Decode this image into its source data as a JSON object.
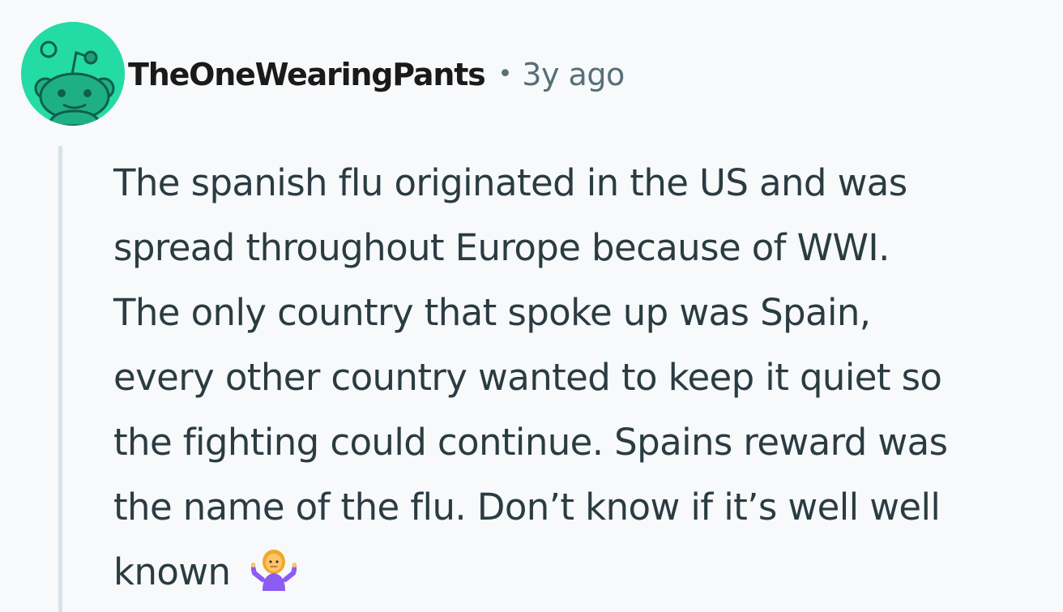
{
  "comment": {
    "author": "TheOneWearingPants",
    "separator": "•",
    "timestamp": "3y ago",
    "avatar_icon": "reddit-snoo-avatar-icon",
    "avatar_color": "#24dba5",
    "body_lines": [
      "The spanish flu originated in the US and was",
      "spread throughout Europe because of WWI.",
      "The only country that spoke up was Spain,",
      "every other country wanted to keep it quiet so",
      "the fighting could continue. Spains reward was",
      "the name of the flu. Don’t know if it’s well well",
      "known"
    ],
    "emoji_icon": "person-shrugging-emoji-icon"
  },
  "colors": {
    "background": "#f7f9fa",
    "author_text": "#1a1a1b",
    "meta_text": "#576f76",
    "body_text": "#2a3c42",
    "thread_line": "#d9e2e6"
  }
}
